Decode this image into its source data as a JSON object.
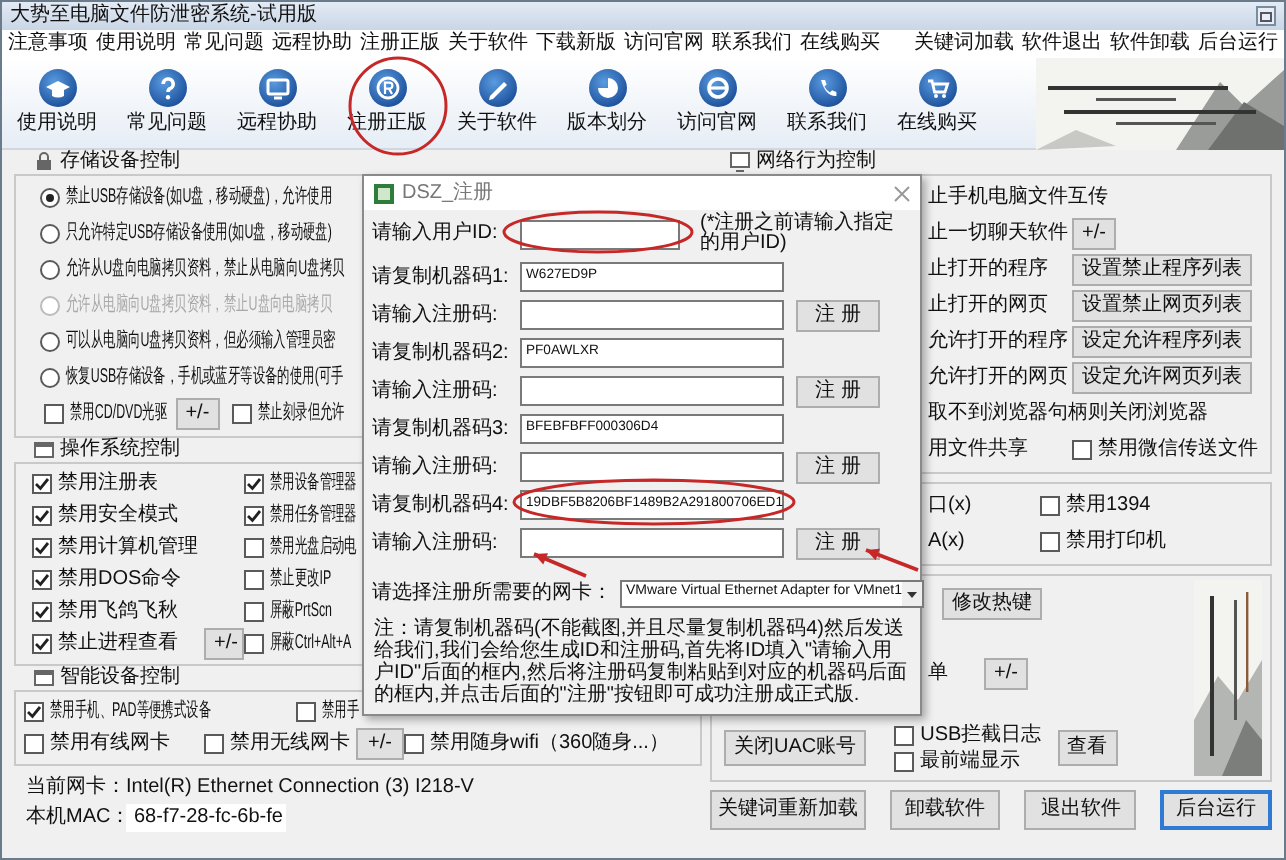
{
  "window": {
    "title": "大势至电脑文件防泄密系统-试用版"
  },
  "menu": {
    "left": [
      "注意事项",
      "使用说明",
      "常见问题",
      "远程协助",
      "注册正版",
      "关于软件",
      "下载新版",
      "访问官网",
      "联系我们",
      "在线购买"
    ],
    "right": [
      "关键词加载",
      "软件退出",
      "软件卸载",
      "后台运行"
    ]
  },
  "toolbar": [
    "使用说明",
    "常见问题",
    "远程协助",
    "注册正版",
    "关于软件",
    "版本划分",
    "访问官网",
    "联系我们",
    "在线购买"
  ],
  "storage": {
    "title": "存储设备控制",
    "options": [
      {
        "label": "禁止USB存储设备(如U盘，移动硬盘)，允许使用",
        "selected": true,
        "disabled": false
      },
      {
        "label": "只允许特定USB存储设备使用(如U盘，移动硬盘)",
        "selected": false,
        "disabled": false
      },
      {
        "label": "允许从U盘向电脑拷贝资料，禁止从电脑向U盘拷贝",
        "selected": false,
        "disabled": false
      },
      {
        "label": "允许从电脑向U盘拷贝资料，禁止U盘向电脑拷贝",
        "selected": false,
        "disabled": true
      },
      {
        "label": "可以从电脑向U盘拷贝资料，但必须输入管理员密",
        "selected": false,
        "disabled": false
      },
      {
        "label": "恢复USB存储设备，手机或蓝牙等设备的使用(可手",
        "selected": false,
        "disabled": false
      }
    ],
    "extras": [
      {
        "kind": "checkbox",
        "label": "禁用CD/DVD光驱",
        "checked": false
      },
      {
        "kind": "button",
        "label": "+/-"
      },
      {
        "kind": "checkbox",
        "label": "禁止刻录但允许",
        "checked": false
      }
    ]
  },
  "os": {
    "title": "操作系统控制",
    "rows": [
      [
        {
          "kind": "checkbox",
          "label": "禁用注册表",
          "checked": true
        },
        {
          "kind": "blank"
        },
        {
          "kind": "checkbox",
          "label": "禁用设备管理器",
          "checked": true
        }
      ],
      [
        {
          "kind": "checkbox",
          "label": "禁用安全模式",
          "checked": true
        },
        {
          "kind": "blank"
        },
        {
          "kind": "checkbox",
          "label": "禁用任务管理器",
          "checked": true
        }
      ],
      [
        {
          "kind": "checkbox",
          "label": "禁用计算机管理",
          "checked": true
        },
        {
          "kind": "blank"
        },
        {
          "kind": "checkbox",
          "label": "禁用光盘启动电",
          "checked": false
        }
      ],
      [
        {
          "kind": "checkbox",
          "label": "禁用DOS命令",
          "checked": true
        },
        {
          "kind": "blank"
        },
        {
          "kind": "checkbox",
          "label": "禁止更改IP",
          "checked": false
        }
      ],
      [
        {
          "kind": "checkbox",
          "label": "禁用飞鸽飞秋",
          "checked": true
        },
        {
          "kind": "blank"
        },
        {
          "kind": "checkbox",
          "label": "屏蔽PrtScn",
          "checked": false
        }
      ],
      [
        {
          "kind": "checkbox",
          "label": "禁止进程查看",
          "checked": true
        },
        {
          "kind": "button",
          "label": "+/-"
        },
        {
          "kind": "checkbox",
          "label": "屏蔽Ctrl+Alt+A",
          "checked": false
        }
      ]
    ]
  },
  "smart": {
    "title": "智能设备控制",
    "rows": [
      [
        {
          "kind": "checkbox",
          "label": "禁用手机、PAD等便携式设备",
          "checked": true
        },
        {
          "kind": "checkbox",
          "label": "禁用手",
          "checked": false
        }
      ],
      [
        {
          "kind": "checkbox",
          "label": "禁用有线网卡",
          "checked": false
        },
        {
          "kind": "checkbox",
          "label": "禁用无线网卡",
          "checked": false
        },
        {
          "kind": "button",
          "label": "+/-"
        },
        {
          "kind": "checkbox",
          "label": "禁用随身wifi（360随身...）",
          "checked": false
        }
      ]
    ]
  },
  "info": [
    {
      "kind": "text",
      "label": "当前网卡：",
      "value": "Intel(R) Ethernet Connection (3) I218-V"
    },
    {
      "kind": "field",
      "label": "本机MAC：",
      "value": "68-f7-28-fc-6b-fe"
    }
  ],
  "net": {
    "title": "网络行为控制",
    "rows": [
      [
        {
          "kind": "text",
          "label": "止手机电脑文件互传"
        }
      ],
      [
        {
          "kind": "text",
          "label": "止一切聊天软件"
        },
        {
          "kind": "button",
          "label": "+/-"
        }
      ],
      [
        {
          "kind": "text",
          "label": "止打开的程序"
        },
        {
          "kind": "button",
          "label": "设置禁止程序列表"
        }
      ],
      [
        {
          "kind": "text",
          "label": "止打开的网页"
        },
        {
          "kind": "button",
          "label": "设置禁止网页列表"
        }
      ],
      [
        {
          "kind": "text",
          "label": "允许打开的程序"
        },
        {
          "kind": "button",
          "label": "设定允许程序列表"
        }
      ],
      [
        {
          "kind": "text",
          "label": "允许打开的网页"
        },
        {
          "kind": "button",
          "label": "设定允许网页列表"
        }
      ],
      [
        {
          "kind": "text",
          "label": "取不到浏览器句柄则关闭浏览器"
        }
      ],
      [
        {
          "kind": "text",
          "label": "用文件共享"
        },
        {
          "kind": "checkbox",
          "label": "禁用微信传送文件",
          "checked": false
        }
      ]
    ]
  },
  "ports": {
    "rows": [
      [
        {
          "kind": "text",
          "label": "口(x)"
        },
        {
          "kind": "checkbox",
          "label": "禁用1394",
          "checked": false
        }
      ],
      [
        {
          "kind": "text",
          "label": "A(x)"
        },
        {
          "kind": "checkbox",
          "label": "禁用打印机",
          "checked": false
        }
      ]
    ]
  },
  "extra": {
    "hotkey_button": "修改热键",
    "text": "单",
    "toggle": "+/-",
    "uac_button": "关闭UAC账号",
    "checks": [
      {
        "label": "USB拦截日志",
        "checked": false
      },
      {
        "label": "最前端显示",
        "checked": false
      }
    ],
    "view_button": "查看"
  },
  "bottom_buttons": [
    {
      "label": "关键词重新加载",
      "focused": false
    },
    {
      "label": "卸载软件",
      "focused": false
    },
    {
      "label": "退出软件",
      "focused": false
    },
    {
      "label": "后台运行",
      "focused": true
    }
  ],
  "dialog": {
    "title": "DSZ_注册",
    "user_id": {
      "label": "请输入用户ID:",
      "hint": "(*注册之前请输入指定的用户ID)"
    },
    "rows": [
      {
        "kind": "code",
        "label": "请复制机器码1:",
        "value": "W627ED9P"
      },
      {
        "kind": "input",
        "label": "请输入注册码:",
        "button": "注 册"
      },
      {
        "kind": "code",
        "label": "请复制机器码2:",
        "value": "PF0AWLXR"
      },
      {
        "kind": "input",
        "label": "请输入注册码:",
        "button": "注 册"
      },
      {
        "kind": "code",
        "label": "请复制机器码3:",
        "value": "BFEBFBFF000306D4"
      },
      {
        "kind": "input",
        "label": "请输入注册码:",
        "button": "注 册"
      },
      {
        "kind": "code",
        "label": "请复制机器码4:",
        "value": "19DBF5B8206BF1489B2A291800706ED1"
      },
      {
        "kind": "input",
        "label": "请输入注册码:",
        "button": "注 册"
      }
    ],
    "adapter": {
      "label": "请选择注册所需要的网卡：",
      "value": "VMware Virtual Ethernet Adapter for VMnet1"
    },
    "note": "注：请复制机器码(不能截图,并且尽量复制机器码4)然后发送给我们,我们会给您生成ID和注册码,首先将ID填入\"请输入用户ID\"后面的框内,然后将注册码复制粘贴到对应的机器码后面的框内,并点击后面的\"注册\"按钮即可成功注册成正式版."
  }
}
